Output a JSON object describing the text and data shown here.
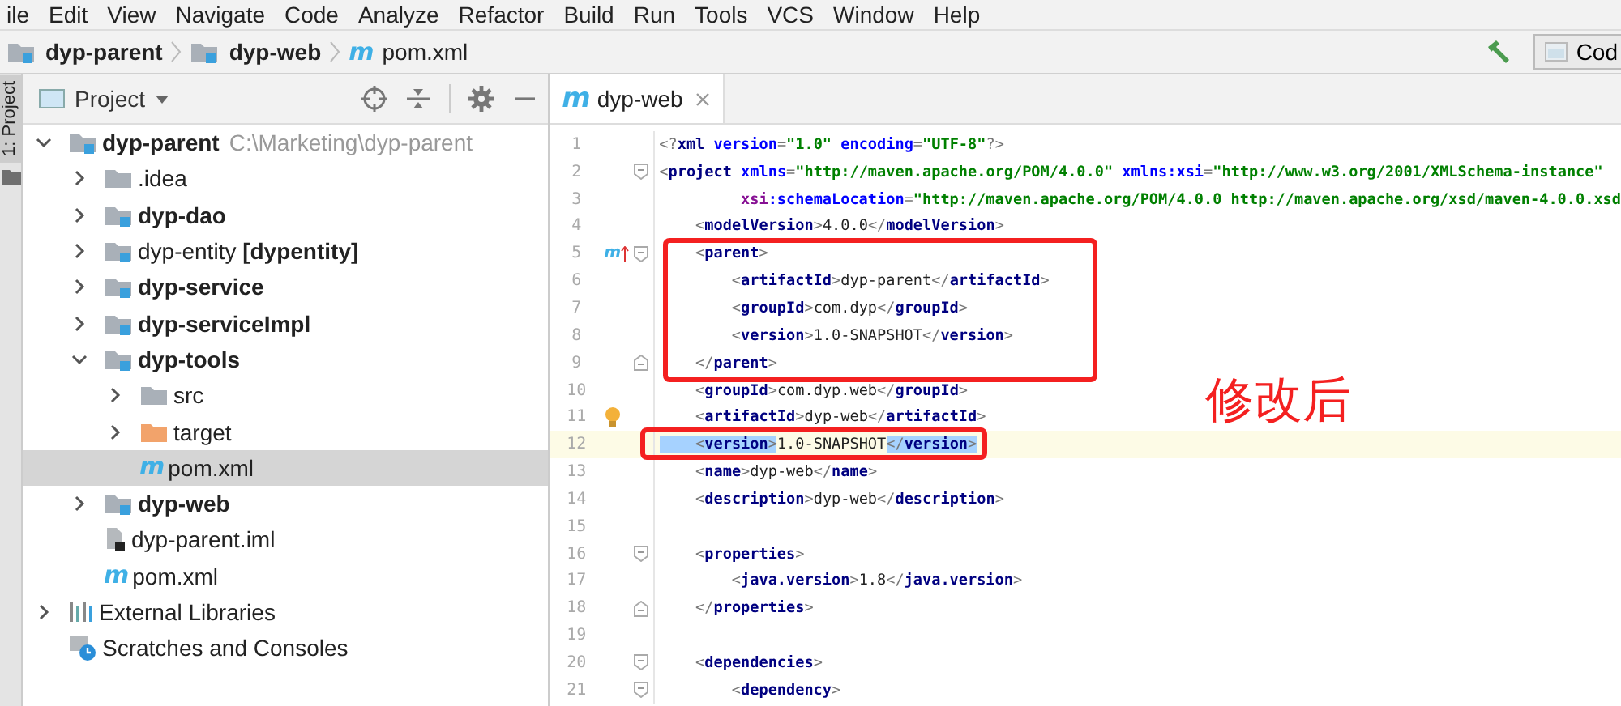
{
  "menu": [
    "ile",
    "Edit",
    "View",
    "Navigate",
    "Code",
    "Analyze",
    "Refactor",
    "Build",
    "Run",
    "Tools",
    "VCS",
    "Window",
    "Help"
  ],
  "breadcrumbs": [
    {
      "kind": "module",
      "label": "dyp-parent"
    },
    {
      "kind": "module",
      "label": "dyp-web"
    },
    {
      "kind": "file",
      "icon": "m",
      "label": "pom.xml"
    }
  ],
  "toolbar": {
    "button": "Cod"
  },
  "tool_strip": {
    "tab": "1: Project"
  },
  "project_panel": {
    "title": "Project",
    "tree": [
      {
        "kind": "module",
        "label": "dyp-parent",
        "path": "C:\\Marketing\\dyp-parent",
        "bold": true,
        "expanded": true,
        "selected": false,
        "children": [
          {
            "kind": "folder",
            "label": ".idea",
            "bold": false,
            "expanded": false,
            "selected": false
          },
          {
            "kind": "module",
            "label": "dyp-dao",
            "bold": true,
            "expanded": false,
            "selected": false
          },
          {
            "kind": "module",
            "label": "dyp-entity **[dypentity]**",
            "bold": false,
            "expanded": false,
            "selected": false
          },
          {
            "kind": "module",
            "label": "dyp-service",
            "bold": true,
            "expanded": false,
            "selected": false
          },
          {
            "kind": "module",
            "label": "dyp-serviceImpl",
            "bold": true,
            "expanded": false,
            "selected": false
          },
          {
            "kind": "module",
            "label": "dyp-tools",
            "bold": true,
            "expanded": true,
            "selected": false,
            "children": [
              {
                "kind": "folder",
                "label": "src",
                "bold": false,
                "expanded": false,
                "selected": false
              },
              {
                "kind": "excluded",
                "label": "target",
                "bold": false,
                "expanded": false,
                "selected": false
              },
              {
                "kind": "maven",
                "icon": "m",
                "label": "pom.xml",
                "bold": false,
                "selected": true
              }
            ]
          },
          {
            "kind": "module",
            "label": "dyp-web",
            "bold": true,
            "expanded": false,
            "selected": false
          },
          {
            "kind": "iml",
            "label": "dyp-parent.iml",
            "bold": false,
            "selected": false
          },
          {
            "kind": "maven",
            "icon": "m",
            "label": "pom.xml",
            "bold": false,
            "selected": false
          }
        ]
      },
      {
        "kind": "libraries",
        "label": "External Libraries",
        "bold": false,
        "expanded": false,
        "selected": false
      },
      {
        "kind": "scratches",
        "label": "Scratches and Consoles",
        "bold": false,
        "selected": false
      }
    ]
  },
  "editor": {
    "tab_icon": "m",
    "tab": "dyp-web",
    "lines": [
      {
        "number": "1",
        "current": false,
        "annotated": false,
        "tokens": [
          {
            "kind": "p",
            "text": "<?"
          },
          {
            "kind": "t",
            "text": "xml"
          },
          {
            "kind": "a",
            "text": " version"
          },
          {
            "kind": "p",
            "text": "="
          },
          {
            "kind": "v",
            "text": "\"1.0\""
          },
          {
            "kind": "a",
            "text": " encoding"
          },
          {
            "kind": "p",
            "text": "="
          },
          {
            "kind": "v",
            "text": "\"UTF-8\""
          },
          {
            "kind": "p",
            "text": "?>"
          }
        ]
      },
      {
        "number": "2",
        "current": false,
        "annotated": false,
        "gutter": [
          {
            "kind": "fold-start"
          }
        ],
        "tokens": [
          {
            "kind": "p",
            "text": "<"
          },
          {
            "kind": "t",
            "text": "project"
          },
          {
            "kind": "a",
            "text": " xmlns"
          },
          {
            "kind": "p",
            "text": "="
          },
          {
            "kind": "v",
            "text": "\"http://maven.apache.org/POM/4.0.0\""
          },
          {
            "kind": "a",
            "text": " xmlns:xsi"
          },
          {
            "kind": "p",
            "text": "="
          },
          {
            "kind": "v",
            "text": "\"http://www.w3.org/2001/XMLSchema-instance\""
          }
        ]
      },
      {
        "number": "3",
        "current": false,
        "annotated": false,
        "tokens": [
          {
            "kind": "n",
            "text": "         xsi"
          },
          {
            "kind": "a",
            "text": ":schemaLocation"
          },
          {
            "kind": "p",
            "text": "="
          },
          {
            "kind": "v",
            "text": "\"http://maven.apache.org/POM/4.0.0 http://maven.apache.org/xsd/maven-4.0.0.xsd"
          }
        ]
      },
      {
        "number": "4",
        "current": false,
        "annotated": false,
        "tokens": [
          {
            "kind": "p",
            "text": "    <"
          },
          {
            "kind": "t",
            "text": "modelVersion"
          },
          {
            "kind": "p",
            "text": ">"
          },
          {
            "kind": "x",
            "text": "4.0.0"
          },
          {
            "kind": "p",
            "text": "</"
          },
          {
            "kind": "t",
            "text": "modelVersion"
          },
          {
            "kind": "p",
            "text": ">"
          }
        ]
      },
      {
        "number": "5",
        "current": false,
        "annotated": true,
        "gutter": [
          {
            "kind": "overrides",
            "text": "m"
          },
          {
            "kind": "fold-start"
          }
        ],
        "tokens": [
          {
            "kind": "p",
            "text": "    <"
          },
          {
            "kind": "t",
            "text": "parent"
          },
          {
            "kind": "p",
            "text": ">"
          }
        ]
      },
      {
        "number": "6",
        "current": false,
        "annotated": true,
        "tokens": [
          {
            "kind": "p",
            "text": "        <"
          },
          {
            "kind": "t",
            "text": "artifactId"
          },
          {
            "kind": "p",
            "text": ">"
          },
          {
            "kind": "x",
            "text": "dyp-parent"
          },
          {
            "kind": "p",
            "text": "</"
          },
          {
            "kind": "t",
            "text": "artifactId"
          },
          {
            "kind": "p",
            "text": ">"
          }
        ]
      },
      {
        "number": "7",
        "current": false,
        "annotated": true,
        "tokens": [
          {
            "kind": "p",
            "text": "        <"
          },
          {
            "kind": "t",
            "text": "groupId"
          },
          {
            "kind": "p",
            "text": ">"
          },
          {
            "kind": "x",
            "text": "com.dyp"
          },
          {
            "kind": "p",
            "text": "</"
          },
          {
            "kind": "t",
            "text": "groupId"
          },
          {
            "kind": "p",
            "text": ">"
          }
        ]
      },
      {
        "number": "8",
        "current": false,
        "annotated": true,
        "tokens": [
          {
            "kind": "p",
            "text": "        <"
          },
          {
            "kind": "t",
            "text": "version"
          },
          {
            "kind": "p",
            "text": ">"
          },
          {
            "kind": "x",
            "text": "1.0-SNAPSHOT"
          },
          {
            "kind": "p",
            "text": "</"
          },
          {
            "kind": "t",
            "text": "version"
          },
          {
            "kind": "p",
            "text": ">"
          }
        ]
      },
      {
        "number": "9",
        "current": false,
        "annotated": true,
        "gutter": [
          {
            "kind": "fold-end"
          }
        ],
        "tokens": [
          {
            "kind": "p",
            "text": "    </"
          },
          {
            "kind": "t",
            "text": "parent"
          },
          {
            "kind": "p",
            "text": ">"
          }
        ]
      },
      {
        "number": "10",
        "current": false,
        "annotated": false,
        "tokens": [
          {
            "kind": "p",
            "text": "    <"
          },
          {
            "kind": "t",
            "text": "groupId"
          },
          {
            "kind": "p",
            "text": ">"
          },
          {
            "kind": "x",
            "text": "com.dyp.web"
          },
          {
            "kind": "p",
            "text": "</"
          },
          {
            "kind": "t",
            "text": "groupId"
          },
          {
            "kind": "p",
            "text": ">"
          }
        ]
      },
      {
        "number": "11",
        "current": false,
        "annotated": false,
        "gutter": [
          {
            "kind": "bulb"
          }
        ],
        "tokens": [
          {
            "kind": "p",
            "text": "    <"
          },
          {
            "kind": "t",
            "text": "artifactId"
          },
          {
            "kind": "p",
            "text": ">"
          },
          {
            "kind": "x",
            "text": "dyp-web"
          },
          {
            "kind": "p",
            "text": "</"
          },
          {
            "kind": "t",
            "text": "artifactId"
          },
          {
            "kind": "p",
            "text": ">"
          }
        ]
      },
      {
        "number": "12",
        "current": true,
        "annotated": true,
        "tokens": [
          {
            "kind": "p",
            "text": "    <",
            "highlighted": true
          },
          {
            "kind": "t",
            "text": "version",
            "highlighted": true
          },
          {
            "kind": "p",
            "text": ">",
            "highlighted": true
          },
          {
            "kind": "x",
            "text": "1.0-SNAPSHOT",
            "highlighted": false
          },
          {
            "kind": "p",
            "text": "</",
            "highlighted": true
          },
          {
            "kind": "t",
            "text": "version",
            "highlighted": true
          },
          {
            "kind": "p",
            "text": ">",
            "highlighted": true
          }
        ]
      },
      {
        "number": "13",
        "current": false,
        "annotated": false,
        "tokens": [
          {
            "kind": "p",
            "text": "    <"
          },
          {
            "kind": "t",
            "text": "name"
          },
          {
            "kind": "p",
            "text": ">"
          },
          {
            "kind": "x",
            "text": "dyp-web"
          },
          {
            "kind": "p",
            "text": "</"
          },
          {
            "kind": "t",
            "text": "name"
          },
          {
            "kind": "p",
            "text": ">"
          }
        ]
      },
      {
        "number": "14",
        "current": false,
        "annotated": false,
        "tokens": [
          {
            "kind": "p",
            "text": "    <"
          },
          {
            "kind": "t",
            "text": "description"
          },
          {
            "kind": "p",
            "text": ">"
          },
          {
            "kind": "x",
            "text": "dyp-web"
          },
          {
            "kind": "p",
            "text": "</"
          },
          {
            "kind": "t",
            "text": "description"
          },
          {
            "kind": "p",
            "text": ">"
          }
        ]
      },
      {
        "number": "15",
        "current": false,
        "annotated": false
      },
      {
        "number": "16",
        "current": false,
        "annotated": false,
        "gutter": [
          {
            "kind": "fold-start"
          }
        ],
        "tokens": [
          {
            "kind": "p",
            "text": "    <"
          },
          {
            "kind": "t",
            "text": "properties"
          },
          {
            "kind": "p",
            "text": ">"
          }
        ]
      },
      {
        "number": "17",
        "current": false,
        "annotated": false,
        "tokens": [
          {
            "kind": "p",
            "text": "        <"
          },
          {
            "kind": "t",
            "text": "java.version"
          },
          {
            "kind": "p",
            "text": ">"
          },
          {
            "kind": "x",
            "text": "1.8"
          },
          {
            "kind": "p",
            "text": "</"
          },
          {
            "kind": "t",
            "text": "java.version"
          },
          {
            "kind": "p",
            "text": ">"
          }
        ]
      },
      {
        "number": "18",
        "current": false,
        "annotated": false,
        "gutter": [
          {
            "kind": "fold-end"
          }
        ],
        "tokens": [
          {
            "kind": "p",
            "text": "    </"
          },
          {
            "kind": "t",
            "text": "properties"
          },
          {
            "kind": "p",
            "text": ">"
          }
        ]
      },
      {
        "number": "19",
        "current": false,
        "annotated": false
      },
      {
        "number": "20",
        "current": false,
        "annotated": false,
        "gutter": [
          {
            "kind": "fold-start"
          }
        ],
        "tokens": [
          {
            "kind": "p",
            "text": "    <"
          },
          {
            "kind": "t",
            "text": "dependencies"
          },
          {
            "kind": "p",
            "text": ">"
          }
        ]
      },
      {
        "number": "21",
        "current": false,
        "annotated": false,
        "gutter": [
          {
            "kind": "fold-start"
          }
        ],
        "tokens": [
          {
            "kind": "p",
            "text": "        <"
          },
          {
            "kind": "t",
            "text": "dependency"
          },
          {
            "kind": "p",
            "text": ">"
          }
        ]
      }
    ],
    "annotation_text": "修改后"
  }
}
